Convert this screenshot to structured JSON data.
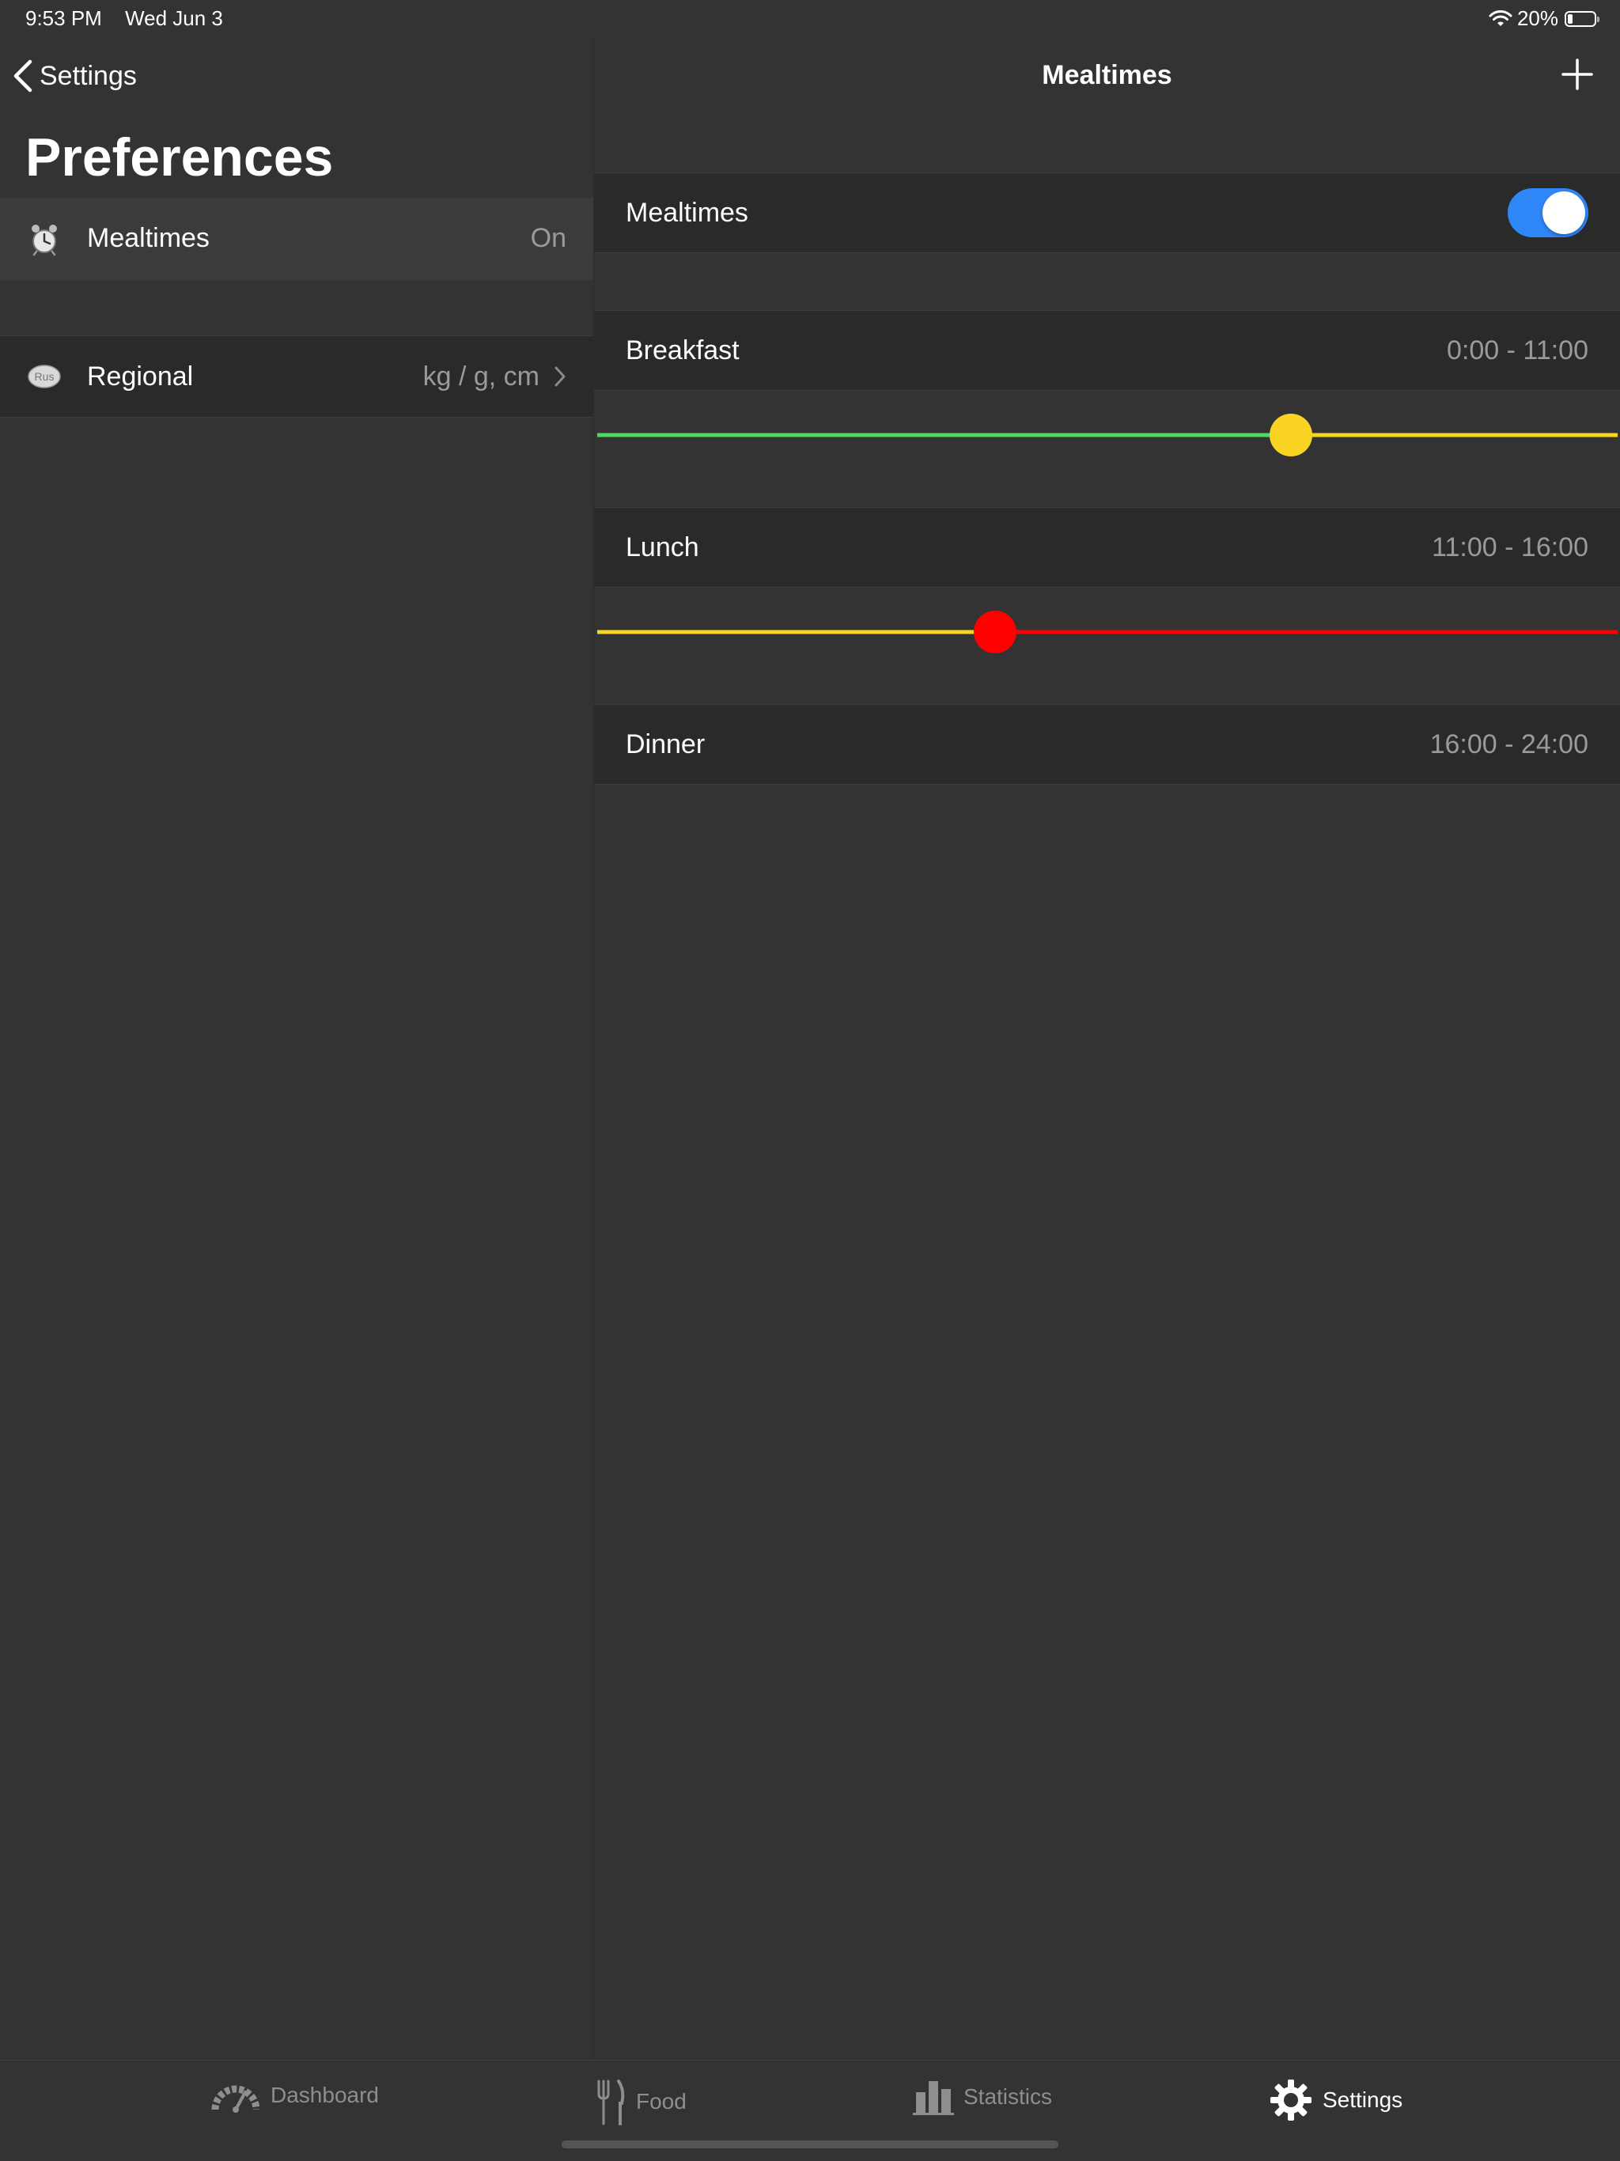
{
  "status_bar": {
    "time": "9:53 PM",
    "date": "Wed Jun 3",
    "battery_text": "20%",
    "battery_level": 0.2
  },
  "master": {
    "back_label": "Settings",
    "title": "Preferences",
    "items": [
      {
        "title": "Mealtimes",
        "value": "On",
        "icon": "alarm-clock-icon"
      },
      {
        "title": "Regional",
        "value": "kg / g, cm",
        "icon": "rus-badge-icon",
        "icon_text": "Rus"
      }
    ]
  },
  "detail": {
    "title": "Mealtimes",
    "master_toggle": {
      "label": "Mealtimes",
      "on": true
    },
    "meals": [
      {
        "name": "Breakfast",
        "range": "0:00 - 11:00",
        "slider_value": 0.68,
        "left_color": "#4cd964",
        "right_color": "#f9d423",
        "knob_color": "#f9d423"
      },
      {
        "name": "Lunch",
        "range": "11:00 - 16:00",
        "slider_value": 0.39,
        "left_color": "#f9d423",
        "right_color": "#ff0000",
        "knob_color": "#ff0000"
      },
      {
        "name": "Dinner",
        "range": "16:00 - 24:00"
      }
    ]
  },
  "tabs": [
    {
      "label": "Dashboard",
      "icon": "speedometer-icon",
      "active": false
    },
    {
      "label": "Food",
      "icon": "fork-knife-icon",
      "active": false
    },
    {
      "label": "Statistics",
      "icon": "bar-chart-icon",
      "active": false
    },
    {
      "label": "Settings",
      "icon": "gear-icon",
      "active": true
    }
  ],
  "colors": {
    "accent": "#2f86f7",
    "background": "#333333",
    "cell": "#2a2a2a"
  }
}
